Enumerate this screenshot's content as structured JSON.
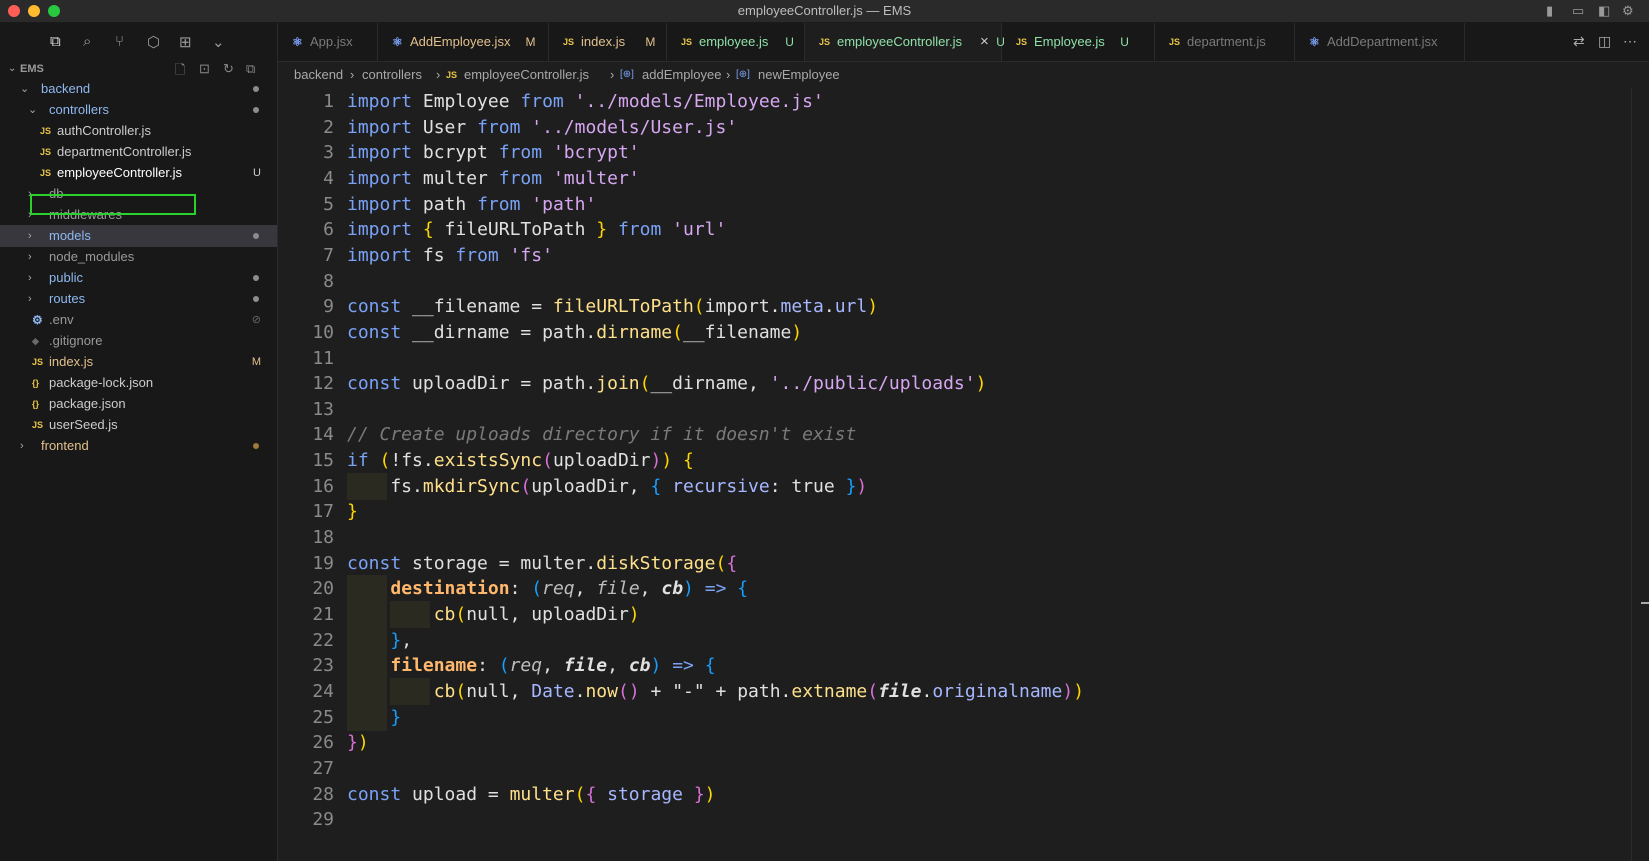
{
  "window": {
    "title": "employeeController.js — EMS"
  },
  "colors": {
    "accent": "#2bd12b",
    "untracked": "#73c991",
    "modified": "#e2c08d",
    "folder_dot": "#8c8c8c"
  },
  "sidebar": {
    "activity_icons": [
      "files-icon",
      "search-icon",
      "source-control-icon",
      "extensions-icon",
      "remote-explorer-icon",
      "chevron-down-icon"
    ],
    "explorer_title": "EMS",
    "explorer_actions": [
      "new-file-icon",
      "new-folder-icon",
      "refresh-icon",
      "collapse-all-icon"
    ],
    "tree": [
      {
        "label": "backend",
        "type": "folder",
        "expanded": true,
        "level": 0,
        "status": "dot"
      },
      {
        "label": "controllers",
        "type": "folder",
        "expanded": true,
        "level": 1,
        "status": "dot"
      },
      {
        "label": "authController.js",
        "type": "js",
        "level": 2,
        "status": ""
      },
      {
        "label": "departmentController.js",
        "type": "js",
        "level": 2,
        "status": ""
      },
      {
        "label": "employeeController.js",
        "type": "js",
        "level": 2,
        "status": "U",
        "selected": true
      },
      {
        "label": "db",
        "type": "folder",
        "expanded": false,
        "level": 1,
        "status": ""
      },
      {
        "label": "middlewares",
        "type": "folder",
        "expanded": false,
        "level": 1,
        "status": ""
      },
      {
        "label": "models",
        "type": "folder",
        "expanded": false,
        "level": 1,
        "status": "dot",
        "highlight": true
      },
      {
        "label": "node_modules",
        "type": "folder",
        "expanded": false,
        "level": 1,
        "status": ""
      },
      {
        "label": "public",
        "type": "folder",
        "expanded": false,
        "level": 1,
        "status": "dot"
      },
      {
        "label": "routes",
        "type": "folder",
        "expanded": false,
        "level": 1,
        "status": "dot"
      },
      {
        "label": ".env",
        "type": "gear",
        "level": 1,
        "status": "ignored"
      },
      {
        "label": ".gitignore",
        "type": "git",
        "level": 1,
        "status": ""
      },
      {
        "label": "index.js",
        "type": "js",
        "level": 1,
        "status": "M"
      },
      {
        "label": "package-lock.json",
        "type": "json",
        "level": 1,
        "status": ""
      },
      {
        "label": "package.json",
        "type": "json",
        "level": 1,
        "status": ""
      },
      {
        "label": "userSeed.js",
        "type": "js",
        "level": 1,
        "status": ""
      },
      {
        "label": "frontend",
        "type": "folder",
        "expanded": false,
        "level": 0,
        "status": "dot-mod"
      }
    ]
  },
  "tabs": [
    {
      "label": "App.jsx",
      "icon": "react",
      "badge": "",
      "dim": true
    },
    {
      "label": "AddEmployee.jsx",
      "icon": "react",
      "badge": "M",
      "dim": false
    },
    {
      "label": "index.js",
      "icon": "js",
      "badge": "M",
      "dim": false
    },
    {
      "label": "employee.js",
      "icon": "js",
      "badge": "U",
      "dim": false
    },
    {
      "label": "employeeController.js",
      "icon": "js",
      "badge": "U",
      "dim": false,
      "active": true
    },
    {
      "label": "Employee.js",
      "icon": "js",
      "badge": "U",
      "dim": false
    },
    {
      "label": "department.js",
      "icon": "js",
      "badge": "",
      "dim": true
    },
    {
      "label": "AddDepartment.jsx",
      "icon": "react",
      "badge": "",
      "dim": true
    }
  ],
  "tab_actions": [
    "compare-icon",
    "split-editor-icon",
    "more-icon"
  ],
  "breadcrumb": [
    "backend",
    "controllers",
    "employeeController.js",
    "addEmployee",
    "newEmployee"
  ],
  "editor": {
    "line_numbers": [
      "1",
      "2",
      "3",
      "4",
      "5",
      "6",
      "7",
      "8",
      "9",
      "10",
      "11",
      "12",
      "13",
      "14",
      "15",
      "16",
      "17",
      "18",
      "19",
      "20",
      "21",
      "22",
      "23",
      "24",
      "25",
      "26",
      "27",
      "28",
      "29"
    ]
  }
}
